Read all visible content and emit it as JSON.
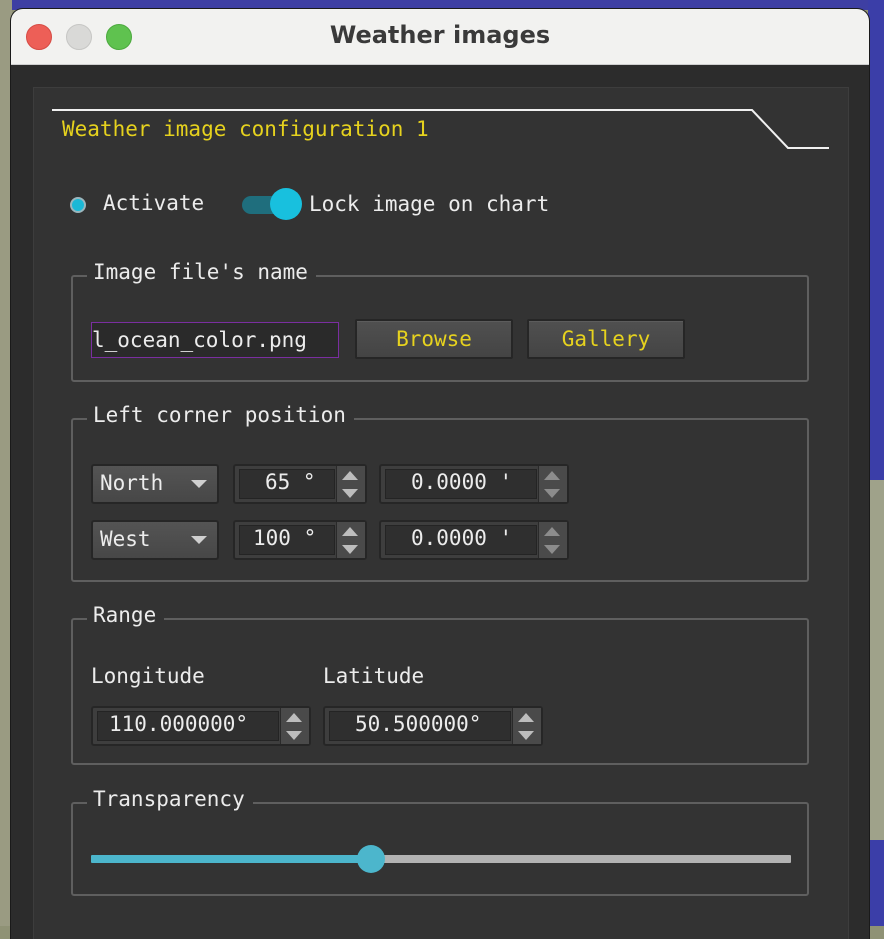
{
  "window": {
    "title": "Weather images"
  },
  "tab": {
    "title": "Weather image configuration 1"
  },
  "options": {
    "activate_label": "Activate",
    "activate_checked": true,
    "lock_label": "Lock image on chart",
    "lock_on": true
  },
  "file_group": {
    "title": "Image file's name",
    "filename": "l_ocean_color.png",
    "browse_label": "Browse",
    "gallery_label": "Gallery"
  },
  "corner_group": {
    "title": "Left corner position",
    "lat_hemisphere": "North",
    "lat_degrees": "65 °",
    "lat_minutes": "0.0000 '",
    "lon_hemisphere": "West",
    "lon_degrees": "100 °",
    "lon_minutes": "0.0000 '"
  },
  "range_group": {
    "title": "Range",
    "longitude_label": "Longitude",
    "latitude_label": "Latitude",
    "longitude_value": "110.000000°",
    "latitude_value": "50.500000°"
  },
  "transparency_group": {
    "title": "Transparency",
    "value_fraction": 0.4
  },
  "colors": {
    "accent_cyan": "#18c0de",
    "label_yellow": "#e6d21e",
    "panel_bg": "#333333"
  },
  "icons": [
    "close-traffic-light",
    "minimize-traffic-light",
    "maximize-traffic-light",
    "chevron-down-icon",
    "spin-up-icon",
    "spin-down-icon"
  ]
}
